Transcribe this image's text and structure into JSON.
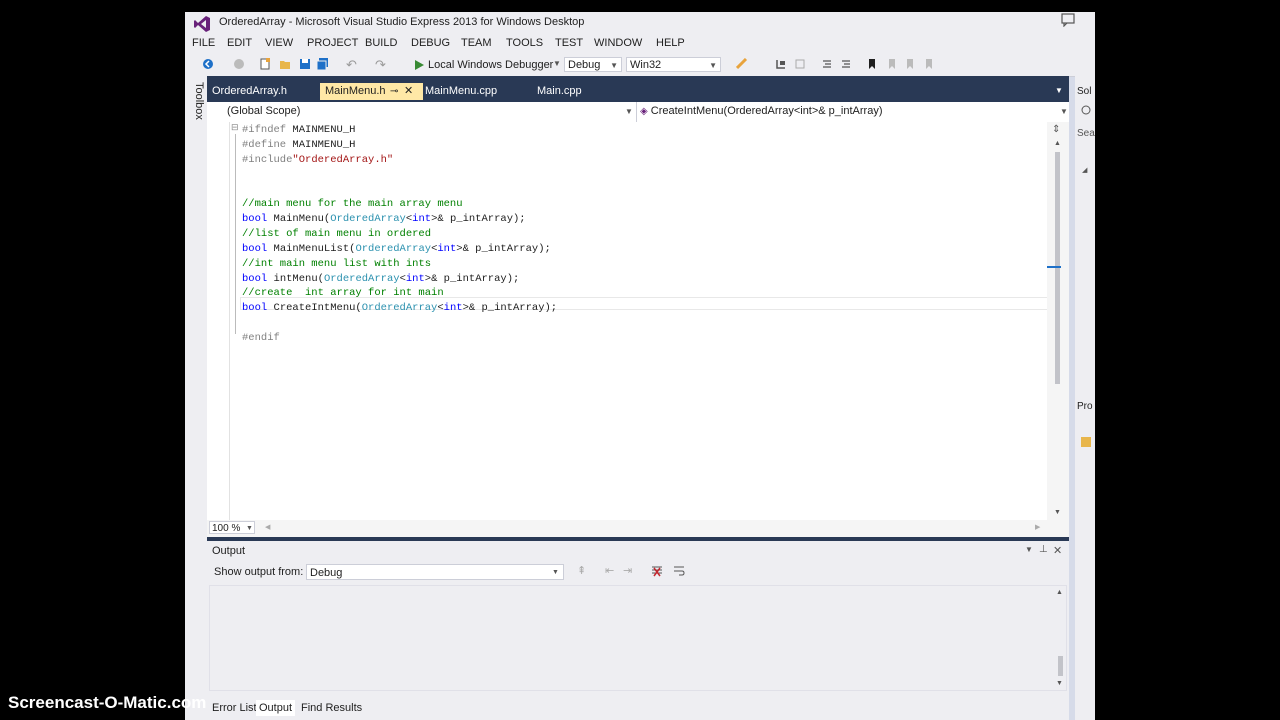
{
  "window": {
    "title": "OrderedArray - Microsoft Visual Studio Express 2013 for Windows Desktop"
  },
  "menu": [
    "FILE",
    "EDIT",
    "VIEW",
    "PROJECT",
    "BUILD",
    "DEBUG",
    "TEAM",
    "TOOLS",
    "TEST",
    "WINDOW",
    "HELP"
  ],
  "toolbar": {
    "run_label": "Local Windows Debugger",
    "config": "Debug",
    "platform": "Win32"
  },
  "toolbox_label": "Toolbox",
  "tabs": [
    {
      "label": "OrderedArray.h",
      "active": false
    },
    {
      "label": "MainMenu.h",
      "active": true
    },
    {
      "label": "MainMenu.cpp",
      "active": false
    },
    {
      "label": "Main.cpp",
      "active": false
    }
  ],
  "nav": {
    "scope": "(Global Scope)",
    "member": "CreateIntMenu(OrderedArray<int>& p_intArray)"
  },
  "code": [
    [
      [
        "pp",
        "#ifndef "
      ],
      [
        "pl",
        "MAINMENU_H"
      ]
    ],
    [
      [
        "pp",
        "#define "
      ],
      [
        "pl",
        "MAINMENU_H"
      ]
    ],
    [
      [
        "pp",
        "#include"
      ],
      [
        "st",
        "\"OrderedArray.h\""
      ]
    ],
    [],
    [],
    [
      [
        "cm",
        "//main menu for the main array menu"
      ]
    ],
    [
      [
        "kw",
        "bool "
      ],
      [
        "pl",
        "MainMenu("
      ],
      [
        "ty",
        "OrderedArray"
      ],
      [
        "pl",
        "<"
      ],
      [
        "kw",
        "int"
      ],
      [
        "pl",
        ">& p_intArray);"
      ]
    ],
    [
      [
        "cm",
        "//list of main menu in ordered"
      ]
    ],
    [
      [
        "kw",
        "bool "
      ],
      [
        "pl",
        "MainMenuList("
      ],
      [
        "ty",
        "OrderedArray"
      ],
      [
        "pl",
        "<"
      ],
      [
        "kw",
        "int"
      ],
      [
        "pl",
        ">& p_intArray);"
      ]
    ],
    [
      [
        "cm",
        "//int main menu list with ints"
      ]
    ],
    [
      [
        "kw",
        "bool "
      ],
      [
        "pl",
        "intMenu("
      ],
      [
        "ty",
        "OrderedArray"
      ],
      [
        "pl",
        "<"
      ],
      [
        "kw",
        "int"
      ],
      [
        "pl",
        ">& p_intArray);"
      ]
    ],
    [
      [
        "cm",
        "//create  int array for int main"
      ]
    ],
    [
      [
        "kw",
        "bool "
      ],
      [
        "pl",
        "CreateIntMenu("
      ],
      [
        "ty",
        "OrderedArray"
      ],
      [
        "pl",
        "<"
      ],
      [
        "kw",
        "int"
      ],
      [
        "pl",
        ">& p_intArray);"
      ]
    ],
    [],
    [
      [
        "pp",
        "#endif"
      ]
    ]
  ],
  "zoom": "100 %",
  "output": {
    "title": "Output",
    "show_label": "Show output from:",
    "source": "Debug"
  },
  "bottom_tabs": [
    "Error List",
    "Output",
    "Find Results"
  ],
  "right_panel": {
    "top_label": "Sol",
    "search_label": "Sea",
    "props_label": "Pro"
  },
  "watermark": "Screencast-O-Matic.com",
  "colors": {
    "accent": "#68217a",
    "active_tab": "#ffe8a6",
    "doc_well": "#293955"
  }
}
